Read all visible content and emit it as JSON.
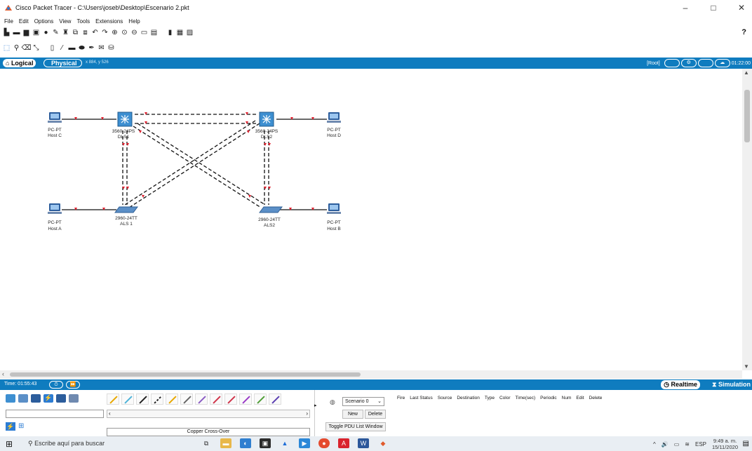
{
  "window": {
    "title": "Cisco Packet Tracer - C:\\Users\\joseb\\Desktop\\Escenario 2.pkt",
    "controls": [
      "–",
      "□",
      "✕"
    ]
  },
  "menu": [
    "File",
    "Edit",
    "Options",
    "View",
    "Tools",
    "Extensions",
    "Help"
  ],
  "help_symbol": "?",
  "tabs": {
    "logical": "Logical",
    "physical": "Physical",
    "coords": "x 884, y 526",
    "root": "[Root]",
    "clock": "01:22:00"
  },
  "topology": {
    "devices": [
      {
        "id": "hostC",
        "model": "PC-PT",
        "name": "Host C"
      },
      {
        "id": "hostD",
        "model": "PC-PT",
        "name": "Host D"
      },
      {
        "id": "hostA",
        "model": "PC-PT",
        "name": "Host A"
      },
      {
        "id": "hostB",
        "model": "PC-PT",
        "name": "Host B"
      },
      {
        "id": "dls1",
        "model": "3560-24PS",
        "name": "DLS1"
      },
      {
        "id": "dls2",
        "model": "3560-24PS",
        "name": "DLS2"
      },
      {
        "id": "als1",
        "model": "2960-24TT",
        "name": "ALS 1"
      },
      {
        "id": "als2",
        "model": "2960-24TT",
        "name": "ALS2"
      }
    ]
  },
  "status": {
    "time": "Time: 01:55:43",
    "realtime": "Realtime",
    "simulation": "Simulation"
  },
  "bottom": {
    "cable_selected": "Copper Cross-Over",
    "scenario": "Scenario 0",
    "new_btn": "New",
    "delete_btn": "Delete",
    "toggle_btn": "Toggle PDU List Window",
    "pdu_headers": [
      "Fire",
      "Last Status",
      "Source",
      "Destination",
      "Type",
      "Color",
      "Time(sec)",
      "Periodic",
      "Num",
      "Edit",
      "Delete"
    ]
  },
  "taskbar": {
    "search_placeholder": "Escribe aquí para buscar",
    "lang": "ESP",
    "time": "9:49 a. m.",
    "date": "15/11/2020"
  },
  "colors": {
    "accent": "#0f7cbf",
    "link_marker": "#e0202e"
  }
}
